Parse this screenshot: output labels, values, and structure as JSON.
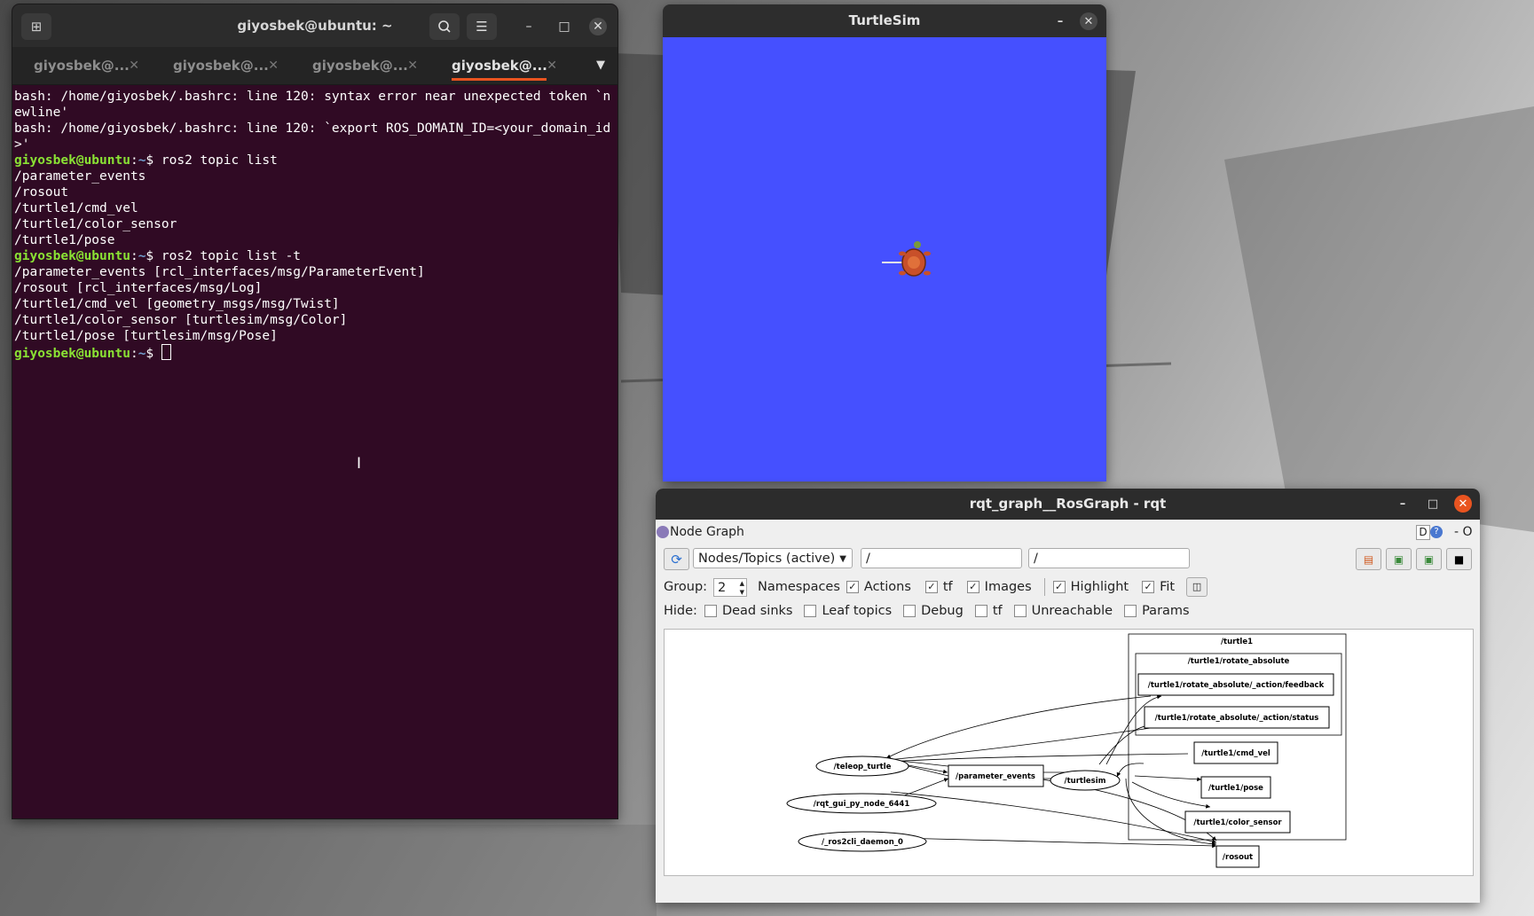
{
  "terminal": {
    "title": "giyosbek@ubuntu: ~",
    "tabs": [
      "giyosbek@...",
      "giyosbek@...",
      "giyosbek@...",
      "giyosbek@..."
    ],
    "active_tab": 3,
    "lines": [
      {
        "type": "text",
        "text": "bash: /home/giyosbek/.bashrc: line 120: syntax error near unexpected token `newline'"
      },
      {
        "type": "text",
        "text": "bash: /home/giyosbek/.bashrc: line 120: `export ROS_DOMAIN_ID=<your_domain_id>'"
      },
      {
        "type": "prompt",
        "user": "giyosbek@ubuntu",
        "path": "~",
        "cmd": "ros2 topic list"
      },
      {
        "type": "text",
        "text": "/parameter_events"
      },
      {
        "type": "text",
        "text": "/rosout"
      },
      {
        "type": "text",
        "text": "/turtle1/cmd_vel"
      },
      {
        "type": "text",
        "text": "/turtle1/color_sensor"
      },
      {
        "type": "text",
        "text": "/turtle1/pose"
      },
      {
        "type": "prompt",
        "user": "giyosbek@ubuntu",
        "path": "~",
        "cmd": "ros2 topic list -t"
      },
      {
        "type": "text",
        "text": "/parameter_events [rcl_interfaces/msg/ParameterEvent]"
      },
      {
        "type": "text",
        "text": "/rosout [rcl_interfaces/msg/Log]"
      },
      {
        "type": "text",
        "text": "/turtle1/cmd_vel [geometry_msgs/msg/Twist]"
      },
      {
        "type": "text",
        "text": "/turtle1/color_sensor [turtlesim/msg/Color]"
      },
      {
        "type": "text",
        "text": "/turtle1/pose [turtlesim/msg/Pose]"
      },
      {
        "type": "prompt",
        "user": "giyosbek@ubuntu",
        "path": "~",
        "cmd": "",
        "cursor": true
      }
    ]
  },
  "turtlesim": {
    "title": "TurtleSim",
    "background_color": "#4550ff"
  },
  "rqt": {
    "title": "rqt_graph__RosGraph - rqt",
    "plugin_title": "Node Graph",
    "plugin_right_label": "D",
    "plugin_right_extra": "- O",
    "mode_select": "Nodes/Topics (active)",
    "filter1": "/",
    "filter2": "/",
    "group_label": "Group:",
    "group_value": "2",
    "options": [
      {
        "label": "Namespaces",
        "checked": false
      },
      {
        "label": "Actions",
        "checked": true
      },
      {
        "label": "tf",
        "checked": true
      },
      {
        "label": "Images",
        "checked": true
      },
      {
        "label": "Highlight",
        "checked": true
      },
      {
        "label": "Fit",
        "checked": true
      }
    ],
    "hide_label": "Hide:",
    "hide_options": [
      {
        "label": "Dead sinks",
        "checked": false
      },
      {
        "label": "Leaf topics",
        "checked": false
      },
      {
        "label": "Debug",
        "checked": false
      },
      {
        "label": "tf",
        "checked": false
      },
      {
        "label": "Unreachable",
        "checked": false
      },
      {
        "label": "Params",
        "checked": false
      }
    ],
    "graph": {
      "group_outer": "/turtle1",
      "group_inner": "/turtle1/rotate_absolute",
      "nodes": {
        "teleop": "/teleop_turtle",
        "rqt_node": "/rqt_gui_py_node_6441",
        "daemon": "/_ros2cli_daemon_0",
        "turtlesim": "/turtlesim"
      },
      "topics": {
        "feedback": "/turtle1/rotate_absolute/_action/feedback",
        "status": "/turtle1/rotate_absolute/_action/status",
        "cmd_vel": "/turtle1/cmd_vel",
        "pose": "/turtle1/pose",
        "color": "/turtle1/color_sensor",
        "params": "/parameter_events",
        "rosout": "/rosout"
      }
    }
  }
}
